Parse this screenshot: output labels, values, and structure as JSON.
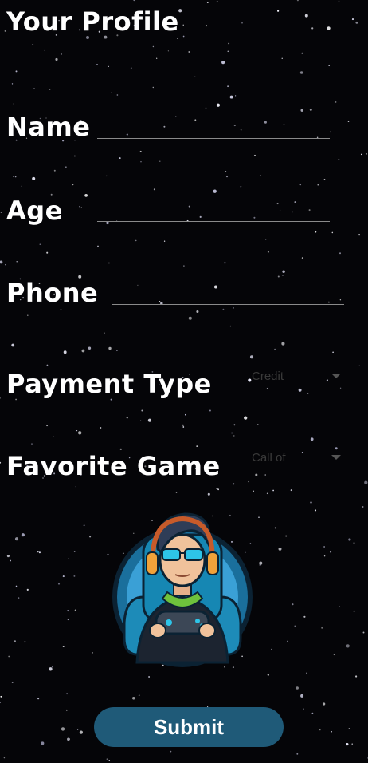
{
  "header": {
    "title": "Your Profile"
  },
  "form": {
    "name_label": "Name",
    "name_value": "",
    "age_label": "Age",
    "age_value": "",
    "phone_label": "Phone",
    "phone_value": "",
    "payment_label": "Payment Type",
    "payment_selected": "Credit",
    "game_label": "Favorite Game",
    "game_selected": "Call of"
  },
  "avatar": {
    "icon": "gamer-avatar-icon"
  },
  "actions": {
    "submit_label": "Submit"
  },
  "colors": {
    "background": "#050508",
    "submit_button": "#1f5a78",
    "underline": "#8a8a8a"
  }
}
